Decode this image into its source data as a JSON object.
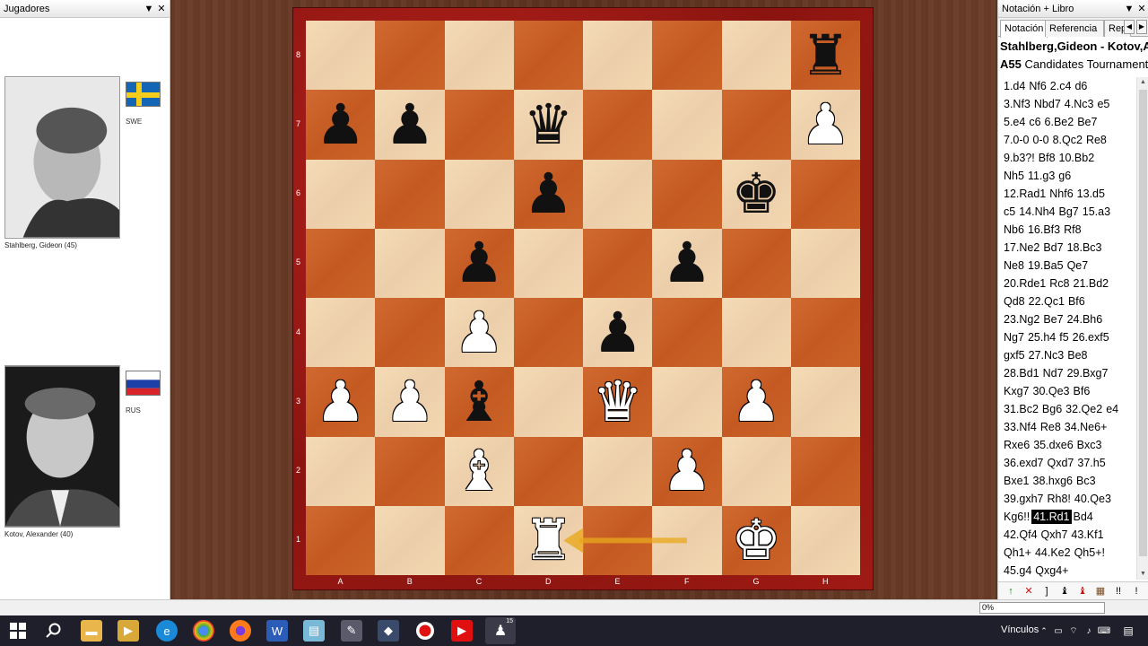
{
  "left_panel": {
    "title": "Jugadores",
    "white_player": {
      "name": "Stahlberg, Gideon  (45)",
      "country": "SWE",
      "flag": "sweden-flag"
    },
    "black_player": {
      "name": "Kotov, Alexander  (40)",
      "country": "RUS",
      "flag": "russia-flag"
    }
  },
  "board": {
    "files": [
      "A",
      "B",
      "C",
      "D",
      "E",
      "F",
      "G",
      "H"
    ],
    "ranks": [
      "8",
      "7",
      "6",
      "5",
      "4",
      "3",
      "2",
      "1"
    ],
    "colors": {
      "light": "#f2d8b2",
      "dark": "#cc6428",
      "frame": "#a01a14",
      "arrow": "#e8a81c"
    },
    "pieces": [
      {
        "square": "h8",
        "color": "black",
        "glyph": "♜",
        "name": "black-rook"
      },
      {
        "square": "a7",
        "color": "black",
        "glyph": "♟",
        "name": "black-pawn"
      },
      {
        "square": "b7",
        "color": "black",
        "glyph": "♟",
        "name": "black-pawn"
      },
      {
        "square": "d7",
        "color": "black",
        "glyph": "♛",
        "name": "black-queen"
      },
      {
        "square": "h7",
        "color": "white",
        "glyph": "♟",
        "name": "white-pawn"
      },
      {
        "square": "d6",
        "color": "black",
        "glyph": "♟",
        "name": "black-pawn"
      },
      {
        "square": "g6",
        "color": "black",
        "glyph": "♚",
        "name": "black-king"
      },
      {
        "square": "c5",
        "color": "black",
        "glyph": "♟",
        "name": "black-pawn"
      },
      {
        "square": "f5",
        "color": "black",
        "glyph": "♟",
        "name": "black-pawn"
      },
      {
        "square": "c4",
        "color": "white",
        "glyph": "♟",
        "name": "white-pawn"
      },
      {
        "square": "e4",
        "color": "black",
        "glyph": "♟",
        "name": "black-pawn"
      },
      {
        "square": "a3",
        "color": "white",
        "glyph": "♟",
        "name": "white-pawn"
      },
      {
        "square": "b3",
        "color": "white",
        "glyph": "♟",
        "name": "white-pawn"
      },
      {
        "square": "c3",
        "color": "black",
        "glyph": "♝",
        "name": "black-bishop"
      },
      {
        "square": "e3",
        "color": "white",
        "glyph": "♛",
        "name": "white-queen"
      },
      {
        "square": "g3",
        "color": "white",
        "glyph": "♟",
        "name": "white-pawn"
      },
      {
        "square": "c2",
        "color": "white",
        "glyph": "♝",
        "name": "white-bishop"
      },
      {
        "square": "f2",
        "color": "white",
        "glyph": "♟",
        "name": "white-pawn"
      },
      {
        "square": "d1",
        "color": "white",
        "glyph": "♜",
        "name": "white-rook"
      },
      {
        "square": "g1",
        "color": "white",
        "glyph": "♚",
        "name": "white-king"
      }
    ],
    "last_move": {
      "from": "f1",
      "to": "d1"
    }
  },
  "right_panel": {
    "title": "Notación + Libro",
    "tabs": [
      "Notación",
      "Referencia",
      "Repla"
    ],
    "players_line": "Stahlberg,Gideon - Kotov,A",
    "eco": "A55",
    "event": "Candidates Tournament",
    "moves": [
      [
        "1.d4",
        "Nf6",
        "2.c4",
        "d6"
      ],
      [
        "3.Nf3",
        "Nbd7",
        "4.Nc3",
        "e5"
      ],
      [
        "5.e4",
        "c6",
        "6.Be2",
        "Be7"
      ],
      [
        "7.0-0",
        "0-0",
        "8.Qc2",
        "Re8"
      ],
      [
        "9.b3?!",
        "Bf8",
        "10.Bb2"
      ],
      [
        "Nh5",
        "11.g3",
        "g6"
      ],
      [
        "12.Rad1",
        "Nhf6",
        "13.d5"
      ],
      [
        "c5",
        "14.Nh4",
        "Bg7",
        "15.a3"
      ],
      [
        "Nb6",
        "16.Bf3",
        "Rf8"
      ],
      [
        "17.Ne2",
        "Bd7",
        "18.Bc3"
      ],
      [
        "Ne8",
        "19.Ba5",
        "Qe7"
      ],
      [
        "20.Rde1",
        "Rc8",
        "21.Bd2"
      ],
      [
        "Qd8",
        "22.Qc1",
        "Bf6"
      ],
      [
        "23.Ng2",
        "Be7",
        "24.Bh6"
      ],
      [
        "Ng7",
        "25.h4",
        "f5",
        "26.exf5"
      ],
      [
        "gxf5",
        "27.Nc3",
        "Be8"
      ],
      [
        "28.Bd1",
        "Nd7",
        "29.Bxg7"
      ],
      [
        "Kxg7",
        "30.Qe3",
        "Bf6"
      ],
      [
        "31.Bc2",
        "Bg6",
        "32.Qe2",
        "e4"
      ],
      [
        "33.Nf4",
        "Re8",
        "34.Ne6+"
      ],
      [
        "Rxe6",
        "35.dxe6",
        "Bxc3"
      ],
      [
        "36.exd7",
        "Qxd7",
        "37.h5"
      ],
      [
        "Bxe1",
        "38.hxg6",
        "Bc3"
      ],
      [
        "39.gxh7",
        "Rh8!",
        "40.Qe3"
      ],
      [
        "Kg6!!",
        "41.Rd1",
        "Bd4"
      ],
      [
        "42.Qf4",
        "Qxh7",
        "43.Kf1"
      ],
      [
        "Qh1+",
        "44.Ke2",
        "Qh5+!"
      ],
      [
        "45.g4",
        "Qxg4+"
      ]
    ],
    "current_move": "41.Rd1",
    "toolbar": [
      "↑",
      "✕",
      "]",
      "♝",
      "♝",
      "▦",
      "!!",
      "!"
    ]
  },
  "status": {
    "progress": "0%"
  },
  "taskbar": {
    "tray_label": "Vínculos",
    "apps": [
      "windows-start",
      "search",
      "file-explorer",
      "media-player",
      "edge",
      "chrome",
      "firefox",
      "word",
      "notepad",
      "paint",
      "recorder",
      "youtube",
      "chess-app"
    ],
    "chess_badge": "15"
  }
}
